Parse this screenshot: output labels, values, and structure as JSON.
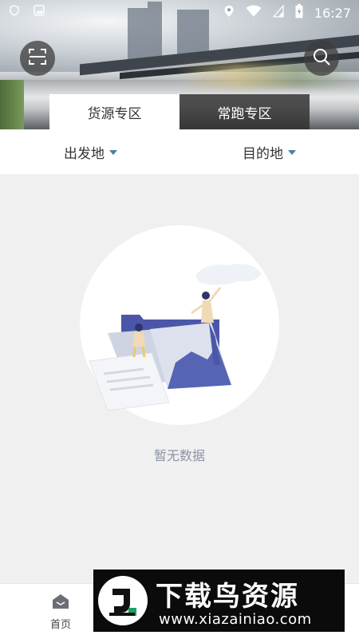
{
  "status_bar": {
    "time": "16:27"
  },
  "header": {
    "tabs": [
      {
        "label": "货源专区",
        "active": true
      },
      {
        "label": "常跑专区",
        "active": false
      }
    ]
  },
  "filters": {
    "origin_label": "出发地",
    "destination_label": "目的地"
  },
  "empty_state": {
    "message": "暂无数据"
  },
  "bottom_nav": {
    "home_label": "首页"
  },
  "watermark": {
    "title": "下载鸟资源",
    "url": "www.xiazainiao.com"
  },
  "colors": {
    "accent": "#4a7fa6",
    "empty_text": "#8a95a3",
    "illustration": "#5565b4"
  },
  "icons": [
    "scan-icon",
    "search-icon",
    "home-icon",
    "filter-caret-icon"
  ]
}
